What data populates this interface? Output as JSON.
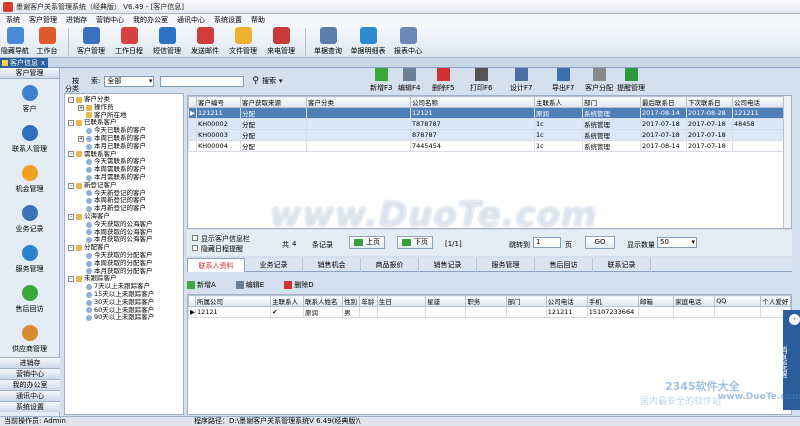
{
  "window": {
    "title": "墨谢客户关系管理系统（经典版） V6.49 - [客户信息]"
  },
  "menu": [
    "系统",
    "客户管理",
    "进销存",
    "营销中心",
    "我的办公室",
    "通讯中心",
    "系统设置",
    "帮助"
  ],
  "toolbar": [
    {
      "label": "隐藏导航",
      "icon": "nav-hide-icon",
      "color": "#4a8ad6"
    },
    {
      "label": "工作台",
      "icon": "desk-icon",
      "color": "#e05b2b"
    },
    {
      "label": "客户管理",
      "icon": "customer-icon",
      "color": "#3b6fbf"
    },
    {
      "label": "工作日程",
      "icon": "calendar-icon",
      "color": "#d94040"
    },
    {
      "label": "短信管理",
      "icon": "sms-icon",
      "color": "#2c72c7"
    },
    {
      "label": "发送邮件",
      "icon": "mail-icon",
      "color": "#d13c3c"
    },
    {
      "label": "文件管理",
      "icon": "folder-icon",
      "color": "#f0b030"
    },
    {
      "label": "来电管理",
      "icon": "phone-icon",
      "color": "#c63a3a"
    },
    {
      "label": "单据查询",
      "icon": "query-icon",
      "color": "#5a7fae"
    },
    {
      "label": "单据明细表",
      "icon": "detail-icon",
      "color": "#2d8bd0"
    },
    {
      "label": "报表中心",
      "icon": "report-icon",
      "color": "#6a88b8"
    }
  ],
  "tab": {
    "label": "客户信息",
    "close": "x"
  },
  "leftnav": {
    "header": "客户管理",
    "items": [
      {
        "label": "客户",
        "icon": "customer-nav-icon",
        "color": "#3c7fcf"
      },
      {
        "label": "联系人管理",
        "icon": "contact-icon",
        "color": "#2f6fbf"
      },
      {
        "label": "机会管理",
        "icon": "star-icon",
        "color": "#f2a020"
      },
      {
        "label": "业务记录",
        "icon": "record-icon",
        "color": "#3a72b8"
      },
      {
        "label": "服务管理",
        "icon": "service-icon",
        "color": "#2b82d0"
      },
      {
        "label": "售后回访",
        "icon": "chat-icon",
        "color": "#3aa83a"
      },
      {
        "label": "供应商管理",
        "icon": "supplier-icon",
        "color": "#d98a30"
      }
    ],
    "groups": [
      "进销存",
      "营销中心",
      "我的办公室",
      "通讯中心",
      "系统设置"
    ]
  },
  "search": {
    "label_a": "按",
    "label_b": "索:",
    "scope": "全部",
    "button": "搜索"
  },
  "tree": {
    "header": "分类",
    "nodes": [
      {
        "t": "客户分类",
        "lvl": 0,
        "box": "-",
        "type": "fold"
      },
      {
        "t": "操作员",
        "lvl": 1,
        "box": "+",
        "type": "fold"
      },
      {
        "t": "客户所在地",
        "lvl": 1,
        "box": "",
        "type": "fold"
      },
      {
        "t": "已联系客户",
        "lvl": 0,
        "box": "-",
        "type": "fold"
      },
      {
        "t": "今天已联系的客户",
        "lvl": 1,
        "box": "",
        "type": "clock"
      },
      {
        "t": "本周已联系的客户",
        "lvl": 1,
        "box": "+",
        "type": "clock"
      },
      {
        "t": "本月已联系的客户",
        "lvl": 1,
        "box": "",
        "type": "clock"
      },
      {
        "t": "需联系客户",
        "lvl": 0,
        "box": "-",
        "type": "fold"
      },
      {
        "t": "今天需联系的客户",
        "lvl": 1,
        "box": "",
        "type": "clock"
      },
      {
        "t": "本周需联系的客户",
        "lvl": 1,
        "box": "",
        "type": "clock"
      },
      {
        "t": "本月需联系的客户",
        "lvl": 1,
        "box": "",
        "type": "clock"
      },
      {
        "t": "新登记客户",
        "lvl": 0,
        "box": "-",
        "type": "fold"
      },
      {
        "t": "今天新登记的客户",
        "lvl": 1,
        "box": "",
        "type": "clock"
      },
      {
        "t": "本周新登记的客户",
        "lvl": 1,
        "box": "",
        "type": "clock"
      },
      {
        "t": "本月新登记的客户",
        "lvl": 1,
        "box": "",
        "type": "clock"
      },
      {
        "t": "公海客户",
        "lvl": 0,
        "box": "-",
        "type": "fold"
      },
      {
        "t": "今天获取的公海客户",
        "lvl": 1,
        "box": "",
        "type": "clock"
      },
      {
        "t": "本周获取的公海客户",
        "lvl": 1,
        "box": "",
        "type": "clock"
      },
      {
        "t": "本月获取的公海客户",
        "lvl": 1,
        "box": "",
        "type": "clock"
      },
      {
        "t": "分配客户",
        "lvl": 0,
        "box": "-",
        "type": "fold"
      },
      {
        "t": "今天获取的分配客户",
        "lvl": 1,
        "box": "",
        "type": "clock"
      },
      {
        "t": "本周获取的分配客户",
        "lvl": 1,
        "box": "",
        "type": "clock"
      },
      {
        "t": "本月获取的分配客户",
        "lvl": 1,
        "box": "",
        "type": "clock"
      },
      {
        "t": "未跟踪客户",
        "lvl": 0,
        "box": "-",
        "type": "fold"
      },
      {
        "t": "7天以上未跟踪客户",
        "lvl": 1,
        "box": "",
        "type": "clock"
      },
      {
        "t": "15天以上未跟踪客户",
        "lvl": 1,
        "box": "",
        "type": "clock"
      },
      {
        "t": "30天以上未跟踪客户",
        "lvl": 1,
        "box": "",
        "type": "clock"
      },
      {
        "t": "60天以上未跟踪客户",
        "lvl": 1,
        "box": "",
        "type": "clock"
      },
      {
        "t": "90天以上未跟踪客户",
        "lvl": 1,
        "box": "",
        "type": "clock"
      }
    ]
  },
  "rtools": [
    {
      "label": "新增F3",
      "icon": "add-icon",
      "color": "#3aa83a"
    },
    {
      "label": "编辑F4",
      "icon": "edit-icon",
      "color": "#6b7f99"
    },
    {
      "label": "删除F5",
      "icon": "delete-icon",
      "color": "#d03030"
    },
    {
      "label": "打印F6",
      "icon": "print-icon",
      "color": "#555"
    },
    {
      "label": "设计F7",
      "icon": "design-icon",
      "color": "#4a6fa5"
    },
    {
      "label": "导出F7",
      "icon": "export-icon",
      "color": "#3c6fae"
    },
    {
      "label": "客户分配",
      "icon": "assign-icon",
      "color": "#888"
    },
    {
      "label": "提醒管理",
      "icon": "remind-icon",
      "color": "#2a9a3a"
    }
  ],
  "grid": {
    "columns": [
      "",
      "客户编号",
      "客户获取来源",
      "客户分类",
      "公司名称",
      "主联系人",
      "部门",
      "最后联系日",
      "下次联系日",
      "公司电话"
    ],
    "rows": [
      [
        "▶",
        "121211",
        "分配",
        "",
        "12121",
        "原润",
        "系统管理",
        "2017-08-14",
        "2017-08-28",
        "121211"
      ],
      [
        "",
        "KH00002",
        "分配",
        "",
        "T878787",
        "1c",
        "系统管理",
        "2017-07-18",
        "2017-07-18",
        "48458"
      ],
      [
        "",
        "KH00003",
        "分配",
        "",
        "878787",
        "1c",
        "系统管理",
        "2017-07-18",
        "2017-07-18",
        ""
      ],
      [
        "",
        "KH00004",
        "分配",
        "",
        "7445454",
        "1c",
        "系统管理",
        "2017-08-14",
        "2017-07-18",
        ""
      ]
    ]
  },
  "pager": {
    "opt1": "显示客户信息栏",
    "opt2": "隐藏日程提醒",
    "total_a": "共",
    "total": "4",
    "total_b": "条记录",
    "prev": "上页",
    "next": "下页",
    "pageinfo": "[1/1]",
    "jump_label": "跳转到",
    "jump_value": "1",
    "page_unit": "页",
    "go": "GO",
    "size_label": "显示数量",
    "size": "50"
  },
  "detail_tabs": [
    "联系人资料",
    "业务记录",
    "销售机会",
    "商品报价",
    "销售记录",
    "服务管理",
    "售后回访",
    "联系记录"
  ],
  "detail_tools": [
    {
      "label": "新增A",
      "color": "#3aa83a"
    },
    {
      "label": "编辑E",
      "color": "#6b7f99"
    },
    {
      "label": "删除D",
      "color": "#d03030"
    }
  ],
  "detail_grid": {
    "columns": [
      "",
      "所属公司",
      "主联系人",
      "联系人姓名",
      "性别",
      "年龄",
      "生日",
      "星座",
      "职务",
      "部门",
      "公司电话",
      "手机",
      "邮箱",
      "家庭电话",
      "QQ",
      "个人爱好"
    ],
    "rows": [
      [
        "▶",
        "12121",
        "✔",
        "原润",
        "男",
        "",
        "",
        "",
        "",
        "",
        "121211",
        "15107233664",
        "",
        "",
        "",
        ""
      ]
    ]
  },
  "status": {
    "operator": "当前操作员: Admin",
    "path": "程序路径：D:\\墨谢客户关系管理系统V 6.49(经典版)\\"
  },
  "msgtab": {
    "arrow": "‹",
    "text": "消息提醒"
  },
  "watermark": {
    "main": "www.DuoTe.com",
    "brand": "2345软件大全",
    "site": "www.DuoTe.com",
    "sub": "国内最安全的软件站"
  }
}
